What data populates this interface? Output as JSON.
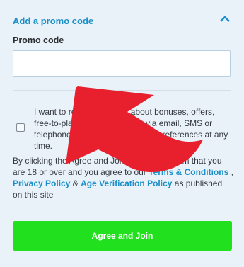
{
  "promo": {
    "header_label": "Add a promo code",
    "field_label": "Promo code",
    "input_value": "",
    "input_placeholder": "",
    "collapse_icon": "chevron-up-icon"
  },
  "consent": {
    "checkbox_checked": false,
    "text": "I want to receive updates about bonuses, offers, free-to-play games and news via email, SMS or telephone. You can change your preferences at any time."
  },
  "terms": {
    "prefix": "By clicking the Agree and Join button, I confirm that you are 18 or over and you agree to our ",
    "terms_link": "Terms & Conditions",
    "sep1": " , ",
    "privacy_link": "Privacy Policy",
    "sep2": " & ",
    "age_link": "Age Verification Policy",
    "suffix": " as published on this site"
  },
  "agree_button_label": "Agree and Join",
  "overlay": {
    "arrow_icon": "red-curved-arrow-icon",
    "arrow_color": "#e8202e"
  },
  "colors": {
    "accent": "#1a8fc9",
    "button": "#21e11e",
    "background": "#eaf2f9"
  }
}
